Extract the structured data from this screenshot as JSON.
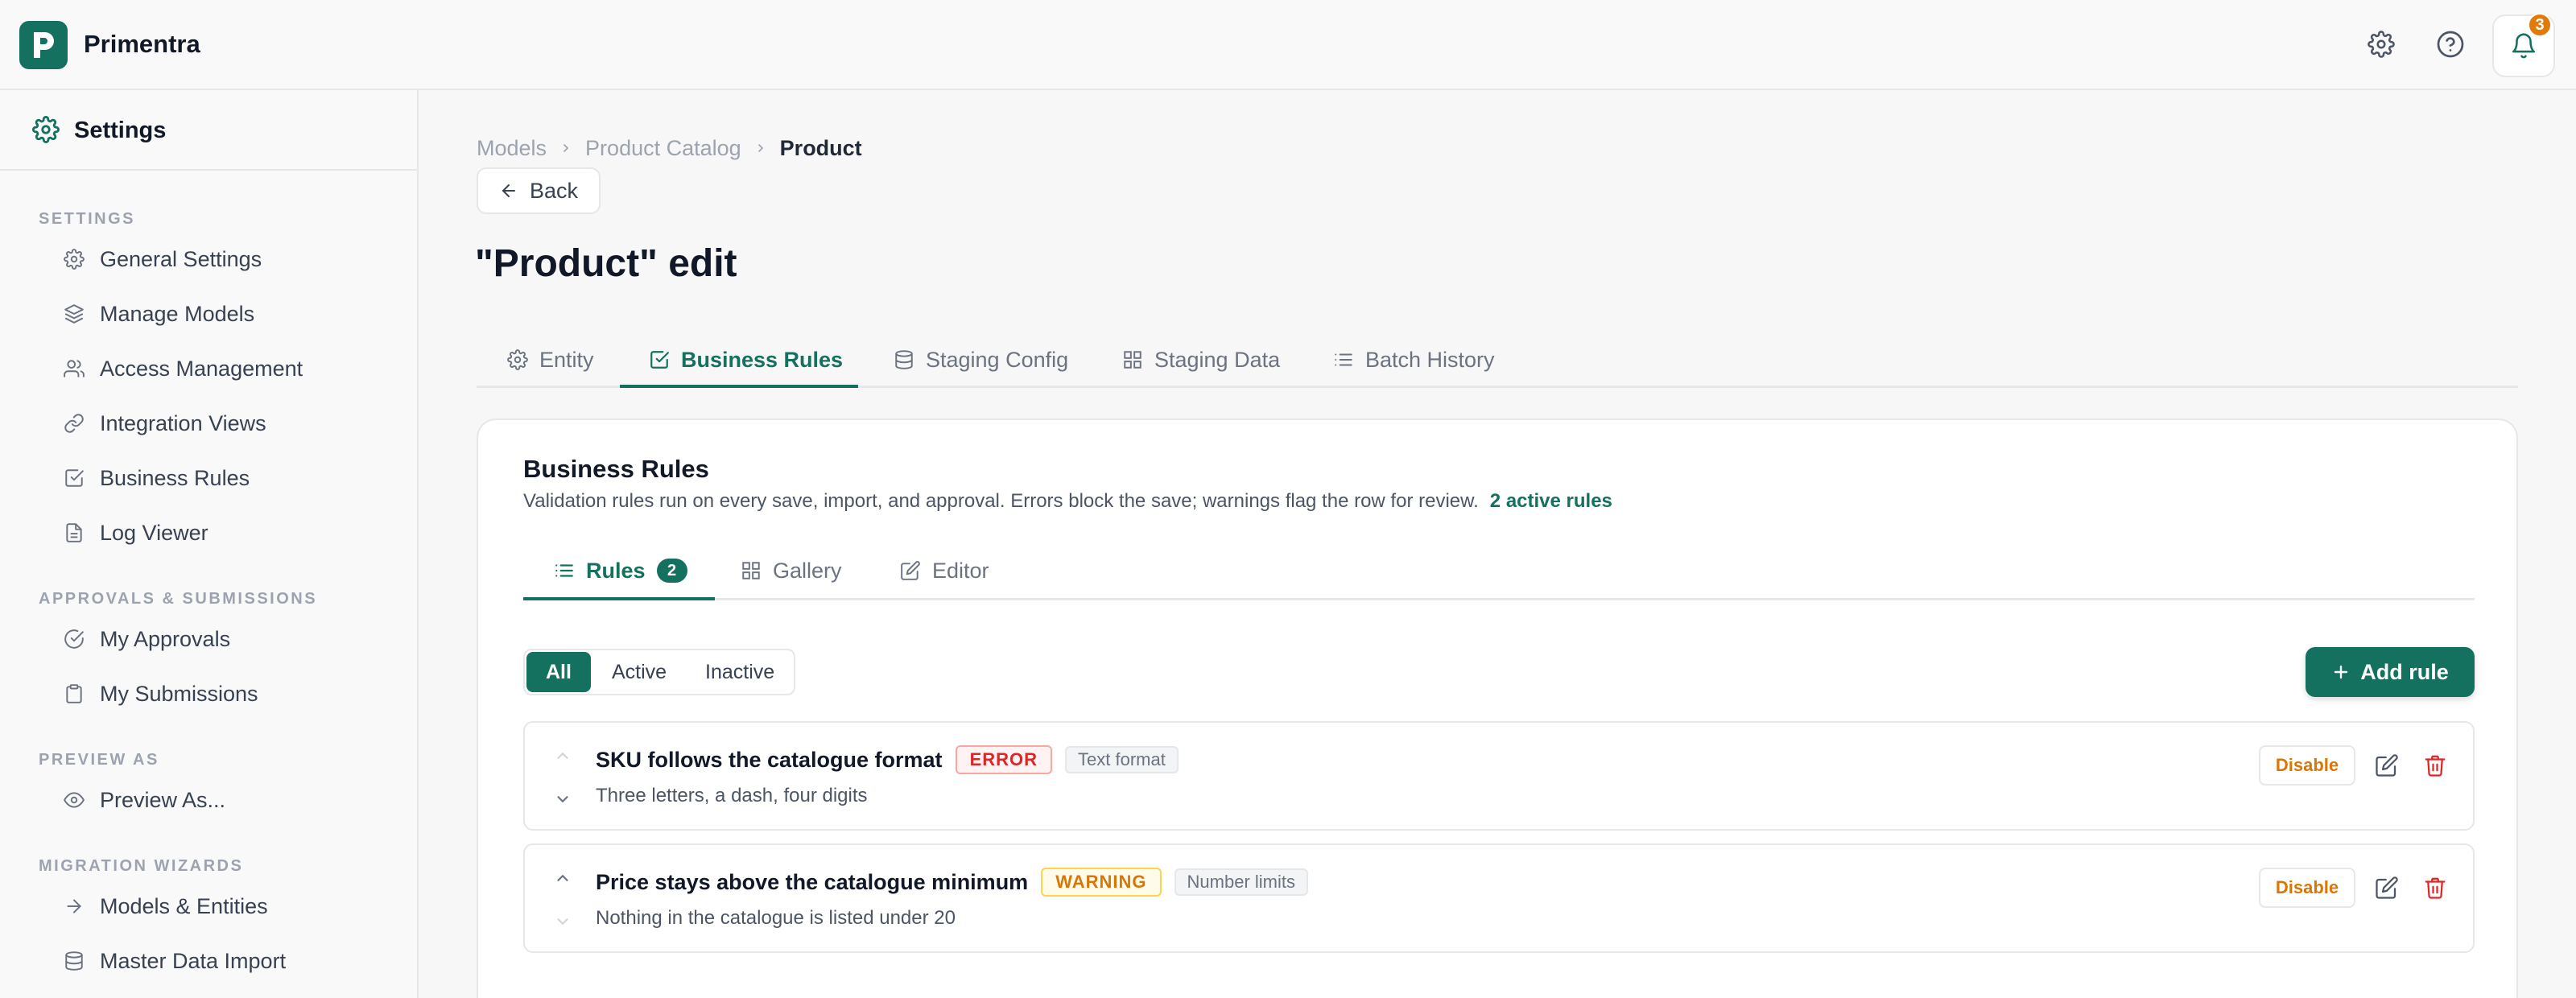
{
  "app": {
    "title": "Primentra",
    "logo_letter": "P",
    "notification_count": "3"
  },
  "sidebar": {
    "header": "Settings",
    "sections": [
      {
        "label": "SETTINGS",
        "items": [
          {
            "label": "General Settings",
            "icon": "gear-icon"
          },
          {
            "label": "Manage Models",
            "icon": "layers-icon"
          },
          {
            "label": "Access Management",
            "icon": "users-icon"
          },
          {
            "label": "Integration Views",
            "icon": "link-icon"
          },
          {
            "label": "Business Rules",
            "icon": "check-square-icon"
          },
          {
            "label": "Log Viewer",
            "icon": "file-text-icon"
          }
        ]
      },
      {
        "label": "APPROVALS & SUBMISSIONS",
        "items": [
          {
            "label": "My Approvals",
            "icon": "check-circle-icon"
          },
          {
            "label": "My Submissions",
            "icon": "clipboard-icon"
          }
        ]
      },
      {
        "label": "PREVIEW AS",
        "items": [
          {
            "label": "Preview As...",
            "icon": "eye-icon"
          }
        ]
      },
      {
        "label": "MIGRATION WIZARDS",
        "items": [
          {
            "label": "Models & Entities",
            "icon": "arrow-right-icon"
          },
          {
            "label": "Master Data Import",
            "icon": "database-icon"
          }
        ]
      }
    ]
  },
  "breadcrumb": [
    "Models",
    "Product Catalog",
    "Product"
  ],
  "back_label": "Back",
  "page_title": "\"Product\" edit",
  "tabs": [
    {
      "label": "Entity",
      "icon": "gear-icon"
    },
    {
      "label": "Business Rules",
      "icon": "check-square-icon",
      "active": true
    },
    {
      "label": "Staging Config",
      "icon": "database-icon"
    },
    {
      "label": "Staging Data",
      "icon": "grid-icon"
    },
    {
      "label": "Batch History",
      "icon": "list-icon"
    }
  ],
  "card": {
    "title": "Business Rules",
    "description": "Validation rules run on every save, import, and approval. Errors block the save; warnings flag the row for review.",
    "active_count": "2 active rules",
    "subtabs": [
      {
        "label": "Rules",
        "count": "2",
        "icon": "list-icon",
        "active": true
      },
      {
        "label": "Gallery",
        "icon": "grid-icon"
      },
      {
        "label": "Editor",
        "icon": "edit-icon"
      }
    ],
    "filters": [
      "All",
      "Active",
      "Inactive"
    ],
    "active_filter": "All",
    "add_label": "Add rule",
    "rules": [
      {
        "name": "SKU follows the catalogue format",
        "severity": "ERROR",
        "type": "Text format",
        "description": "Three letters, a dash, four digits",
        "action": "Disable"
      },
      {
        "name": "Price stays above the catalogue minimum",
        "severity": "WARNING",
        "type": "Number limits",
        "description": "Nothing in the catalogue is listed under 20",
        "action": "Disable"
      }
    ]
  },
  "colors": {
    "brand": "#14705f",
    "error": "#dc2626",
    "warning": "#d97706",
    "badge": "#e07b0a"
  }
}
